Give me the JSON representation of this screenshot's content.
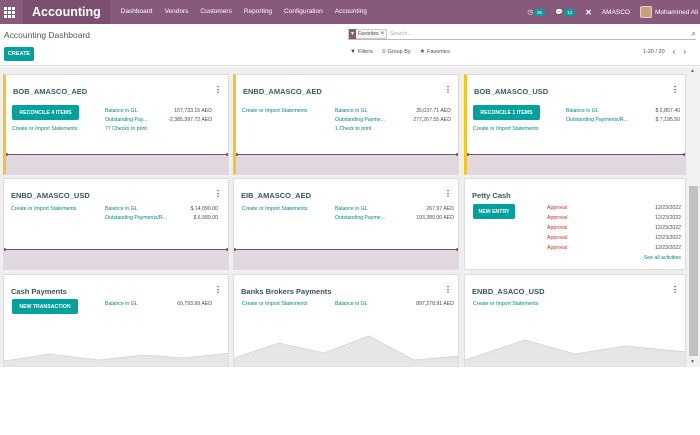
{
  "navbar": {
    "brand": "Accounting",
    "menu": [
      "Dashboard",
      "Vendors",
      "Customers",
      "Reporting",
      "Configuration",
      "Accounting"
    ],
    "activity_count": "36",
    "message_count": "13",
    "company": "AMASCO",
    "user": "Mohammed Ali"
  },
  "control": {
    "title": "Accounting Dashboard",
    "create_label": "CREATE",
    "facet_label": "Favorites",
    "search_placeholder": "Search...",
    "filters_label": "Filters",
    "groupby_label": "Group By",
    "favorites_label": "Favorites",
    "pager": "1-20 / 20"
  },
  "cards": {
    "c1": {
      "title": "BOB_AMASCO_AED",
      "button": "RECONCILE 4 ITEMS",
      "import": "Create or Import Statements",
      "balance_label": "Balance in GL",
      "balance_value": "157,733.15 AED",
      "outstanding_label": "Outstanding Pay...",
      "outstanding_value": "-2,385,397.72 AED",
      "extra": "77 Checks to print"
    },
    "c2": {
      "title": "ENBD_AMASCO_AED",
      "import": "Create or Import Statements",
      "balance_label": "Balance in GL",
      "balance_value": "35,037.71 AED",
      "outstanding_label": "Outstanding Payme...",
      "outstanding_value": "277,267.55 AED",
      "extra": "1 Check to print"
    },
    "c3": {
      "title": "BOB_AMASCO_USD",
      "button": "RECONCILE 1 ITEMS",
      "import": "Create or Import Statements",
      "balance_label": "Balance in GL",
      "balance_value": "$ 2,857.40",
      "outstanding_label": "Outstanding Payments/R...",
      "outstanding_value": "$ 7,195.50"
    },
    "c4": {
      "title": "ENBD_AMASCO_USD",
      "import": "Create or Import Statements",
      "balance_label": "Balance in GL",
      "balance_value": "$ 14,090.00",
      "outstanding_label": "Outstanding Payments/R...",
      "outstanding_value": "$ 6,589.00"
    },
    "c5": {
      "title": "EIB_AMASCO_AED",
      "import": "Create or Import Statements",
      "balance_label": "Balance in GL",
      "balance_value": "267.97 AED",
      "outstanding_label": "Outstanding Payme...",
      "outstanding_value": "193,380.00 AED"
    },
    "c6": {
      "title": "Petty Cash",
      "button": "NEW ENTRY",
      "activities": [
        {
          "label": "Approval",
          "date": "12/23/2022"
        },
        {
          "label": "Approval",
          "date": "12/23/2022"
        },
        {
          "label": "Approval",
          "date": "12/23/2022"
        },
        {
          "label": "Approval",
          "date": "12/23/2022"
        },
        {
          "label": "Approval",
          "date": "12/23/2022"
        }
      ],
      "see_all": "See all activities"
    },
    "c7": {
      "title": "Cash Payments",
      "button": "NEW TRANSACTION",
      "balance_label": "Balance in GL",
      "balance_value": "69,793.99 AED"
    },
    "c8": {
      "title": "Banks Brokers Payments",
      "import": "Create or Import Statements",
      "balance_label": "Balance in GL",
      "balance_value": "897,278.91 AED"
    },
    "c9": {
      "title": "ENBD_ASACO_USD",
      "import": "Create or Import Statements"
    }
  },
  "colors": {
    "navbar": "#875a7b",
    "primary": "#00a09d",
    "warning": "#f3c623",
    "graph": "#e1d8df"
  }
}
